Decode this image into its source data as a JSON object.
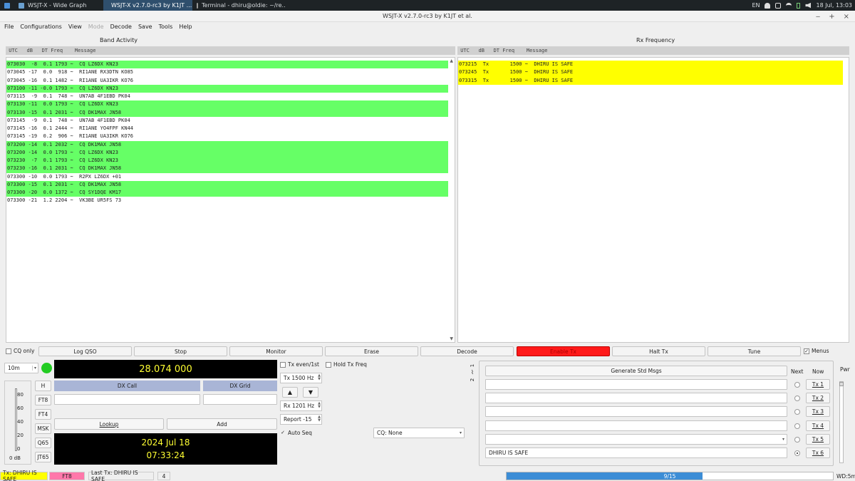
{
  "taskbar": {
    "tasks": [
      "WSJT-X - Wide Graph",
      "WSJT-X   v2.7.0-rc3   by K1JT ...",
      "Terminal - dhiru@oldie: ~/re..."
    ],
    "lang": "EN",
    "clock": "18 Jul, 13:03"
  },
  "window": {
    "title": "WSJT-X   v2.7.0-rc3   by K1JT et al."
  },
  "menu": [
    "File",
    "Configurations",
    "View",
    "Mode",
    "Decode",
    "Save",
    "Tools",
    "Help"
  ],
  "band_activity": {
    "title": "Band Activity",
    "header": " UTC   dB   DT Freq    Message",
    "rows": [
      {
        "text": "073030  -8  0.1 1793 ~  CQ LZ6DX KN23",
        "cq": true
      },
      {
        "text": "073045 -17  0.0  918 ~  RI1ANE RX3DTN KO85",
        "cq": false
      },
      {
        "text": "073045 -16  0.1 1482 ~  RI1ANE UA3IKR KO76",
        "cq": false
      },
      {
        "text": "073100 -11 -0.0 1793 ~  CQ LZ6DX KN23",
        "cq": true
      },
      {
        "text": "073115  -9  0.1  748 ~  UN7AB 4F1EBD PK04",
        "cq": false
      },
      {
        "text": "073130 -11  0.0 1793 ~  CQ LZ6DX KN23",
        "cq": true
      },
      {
        "text": "073130 -15  0.1 2031 ~  CQ DK1MAX JN58",
        "cq": true
      },
      {
        "text": "073145  -9  0.1  748 ~  UN7AB 4F1EBD PK04",
        "cq": false
      },
      {
        "text": "073145 -16  0.1 2444 ~  RI1ANE YO4FPF KN44",
        "cq": false
      },
      {
        "text": "073145 -19  0.2  906 ~  RI1ANE UA3IKR KO76",
        "cq": false
      },
      {
        "text": "073200 -14  0.1 2032 ~  CQ DK1MAX JN58",
        "cq": true
      },
      {
        "text": "073200 -14  0.0 1793 ~  CQ LZ6DX KN23",
        "cq": true
      },
      {
        "text": "073230  -7  0.1 1793 ~  CQ LZ6DX KN23",
        "cq": true
      },
      {
        "text": "073230 -16  0.1 2031 ~  CQ DK1MAX JN58",
        "cq": true
      },
      {
        "text": "073300 -10  0.0 1793 ~  R2PX LZ6DX +01",
        "cq": false
      },
      {
        "text": "073300 -15  0.1 2031 ~  CQ DK1MAX JN58",
        "cq": true
      },
      {
        "text": "073300 -20  0.0 1372 ~  CQ SY1DQE KM17",
        "cq": true
      },
      {
        "text": "073300 -21  1.2 2204 ~  VK3BE UR5FS 73",
        "cq": false
      }
    ]
  },
  "rx_frequency": {
    "title": "Rx Frequency",
    "header": " UTC   dB   DT Freq    Message",
    "rows": [
      {
        "text": "073215  Tx       1500 ~  DHIRU IS SAFE"
      },
      {
        "text": "073245  Tx       1500 ~  DHIRU IS SAFE"
      },
      {
        "text": "073315  Tx       1500 ~  DHIRU IS SAFE"
      }
    ]
  },
  "buttons": {
    "cq_only": "CQ only",
    "log_qso": "Log QSO",
    "stop": "Stop",
    "monitor": "Monitor",
    "erase": "Erase",
    "decode": "Decode",
    "enable_tx": "Enable Tx",
    "halt_tx": "Halt Tx",
    "tune": "Tune",
    "menus": "Menus"
  },
  "controls": {
    "band": "10m",
    "frequency": "28.074 000",
    "meter_ticks": [
      "80",
      "60",
      "40",
      "20",
      "0"
    ],
    "meter_db": "0 dB",
    "mode_buttons": [
      "H",
      "FT8",
      "FT4",
      "MSK",
      "Q65",
      "JT65"
    ],
    "dx_call": "DX Call",
    "dx_grid": "DX Grid",
    "lookup": "Lookup",
    "add": "Add",
    "date": "2024 Jul 18",
    "time": "07:33:24",
    "tx_even": "Tx even/1st",
    "hold_tx_freq": "Hold Tx Freq",
    "tx_freq": "Tx  1500  Hz",
    "rx_freq": "Rx  1201  Hz",
    "report": "Report -15",
    "auto_seq": "Auto Seq",
    "cq_select": "CQ: None"
  },
  "tx_messages": {
    "tab1": "1",
    "tab2": "2",
    "generate": "Generate Std Msgs",
    "next": "Next",
    "now": "Now",
    "pwr": "Pwr",
    "messages": [
      "",
      "",
      "",
      "",
      "",
      "DHIRU IS SAFE"
    ],
    "tx_labels": [
      "Tx 1",
      "Tx 2",
      "Tx 3",
      "Tx 4",
      "Tx 5",
      "Tx 6"
    ]
  },
  "status": {
    "tx": "Tx: DHIRU IS SAFE",
    "mode": "FT8",
    "last_tx": "Last Tx: DHIRU IS SAFE",
    "count": "4",
    "progress": "9/15",
    "progress_fraction": 0.6,
    "wd": "WD:5m"
  },
  "colors": {
    "cq_row": "#66ff66",
    "tx_row": "#ffff00",
    "enable_tx": "#ff1a1a",
    "progress": "#3c8dd6"
  }
}
